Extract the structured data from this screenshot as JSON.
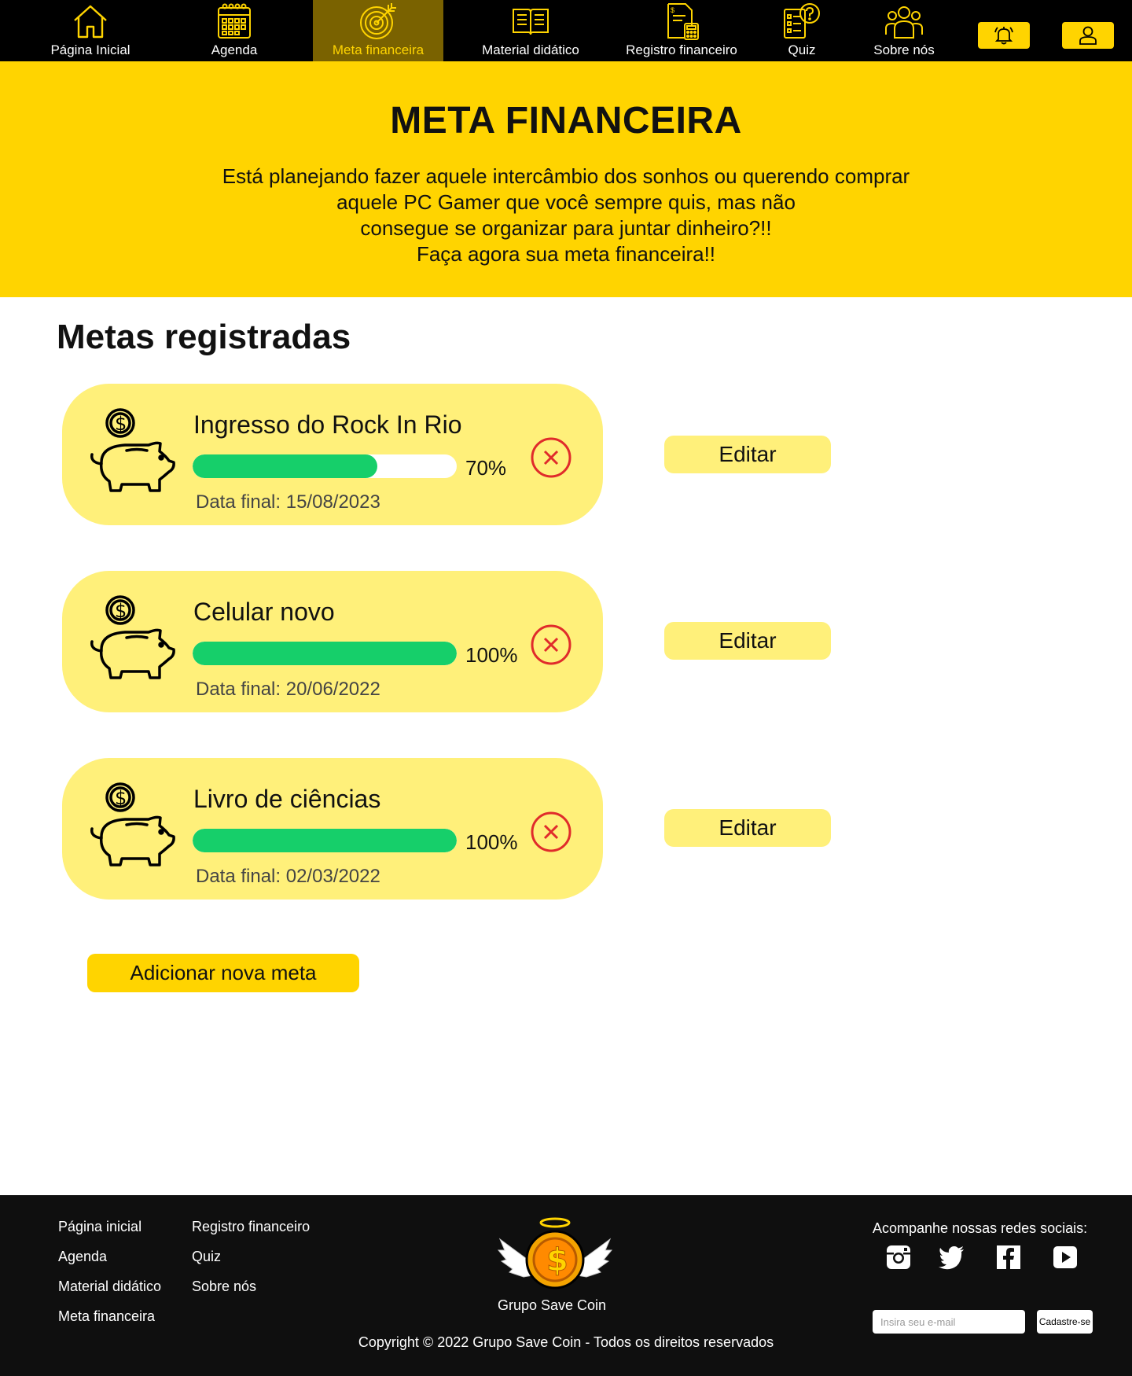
{
  "nav": {
    "items": [
      {
        "label": "Página Inicial",
        "icon": "home-icon"
      },
      {
        "label": "Agenda",
        "icon": "calendar-icon"
      },
      {
        "label": "Meta financeira",
        "icon": "target-icon"
      },
      {
        "label": "Material didático",
        "icon": "book-icon"
      },
      {
        "label": "Registro financeiro",
        "icon": "ledger-icon"
      },
      {
        "label": "Quiz",
        "icon": "quiz-icon"
      },
      {
        "label": "Sobre nós",
        "icon": "team-icon"
      }
    ],
    "active_label": "Meta financeira",
    "bell_icon": "bell-icon",
    "user_icon": "user-icon"
  },
  "hero": {
    "title": "META FINANCEIRA",
    "lines": [
      "Está planejando fazer aquele intercâmbio dos sonhos ou querendo comprar",
      "aquele PC Gamer que você sempre quis, mas não",
      "consegue se organizar para juntar dinheiro?!!",
      "Faça agora sua meta financeira!!"
    ]
  },
  "goals_section": {
    "title": "Metas registradas",
    "goals": [
      {
        "name": "Ingresso do Rock In Rio",
        "progress": 70,
        "progress_label": "70%",
        "date": "Data final: 15/08/2023",
        "edit_label": "Editar"
      },
      {
        "name": "Celular novo",
        "progress": 100,
        "progress_label": "100%",
        "date": "Data final: 20/06/2022",
        "edit_label": "Editar"
      },
      {
        "name": "Livro de ciências",
        "progress": 100,
        "progress_label": "100%",
        "date": "Data final: 02/03/2022",
        "edit_label": "Editar"
      }
    ],
    "add_label": "Adicionar nova meta"
  },
  "footer": {
    "links_col1": [
      "Página inicial",
      "Agenda",
      "Material didático",
      "Meta financeira"
    ],
    "links_col2": [
      "Registro financeiro",
      "Quiz",
      "Sobre nós"
    ],
    "brand": "Grupo Save Coin",
    "copyright": "Copyright © 2022 Grupo Save Coin - Todos os direitos reservados",
    "social_title": "Acompanhe nossas redes sociais:",
    "social_icons": [
      "instagram-icon",
      "twitter-icon",
      "facebook-icon",
      "youtube-icon"
    ],
    "email_placeholder": "Insira seu e-mail",
    "subscribe_label": "Cadastre-se"
  },
  "colors": {
    "nav_bg": "#000000",
    "accent": "#ffd400",
    "card_bg": "#fff07a",
    "progress": "#16cf6a",
    "delete": "#e02b2b",
    "footer_bg": "#0f0f0f"
  }
}
